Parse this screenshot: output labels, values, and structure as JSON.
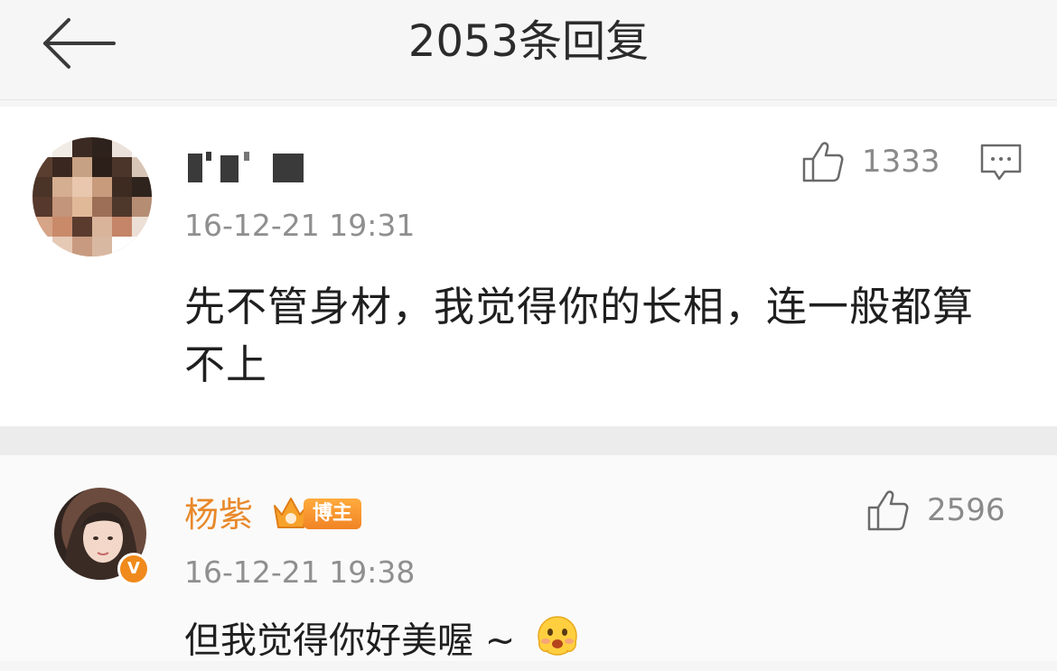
{
  "header": {
    "title": "2053条回复"
  },
  "comment": {
    "timestamp": "16-12-21 19:31",
    "like_count": "1333",
    "text": "先不管身材，我觉得你的长相，连一般都算不上"
  },
  "reply": {
    "username": "杨紫",
    "badge_label": "博主",
    "like_count": "2596",
    "timestamp": "16-12-21 19:38",
    "text": "但我觉得你好美喔 ~"
  },
  "colors": {
    "accent_orange": "#e8892b",
    "badge_orange": "#f18324",
    "muted_text": "#8f8f8f",
    "background": "#f5f5f5"
  }
}
